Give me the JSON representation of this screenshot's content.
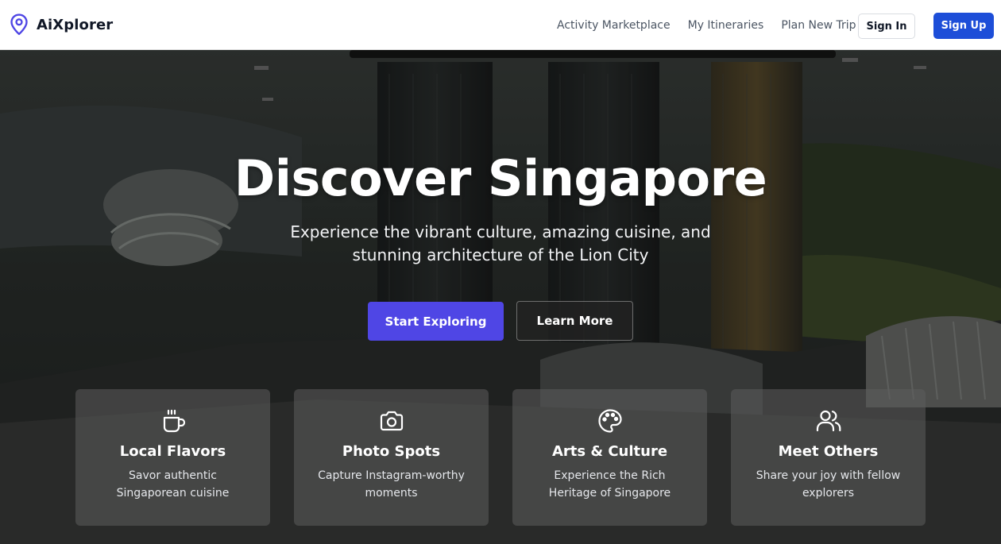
{
  "brand": {
    "name": "AiXplorer",
    "icon": "map-pin-icon",
    "accent": "#4f46e5"
  },
  "nav": {
    "links": [
      {
        "label": "Activity Marketplace"
      },
      {
        "label": "My Itineraries"
      },
      {
        "label": "Plan New Trip"
      }
    ],
    "sign_in": "Sign In",
    "sign_up": "Sign Up"
  },
  "hero": {
    "title": "Discover Singapore",
    "subtitle": "Experience the vibrant culture, amazing cuisine, and stunning architecture of the Lion City",
    "primary_cta": "Start Exploring",
    "secondary_cta": "Learn More"
  },
  "features": [
    {
      "icon": "coffee-cup-icon",
      "title": "Local Flavors",
      "description": "Savor authentic Singaporean cuisine"
    },
    {
      "icon": "camera-icon",
      "title": "Photo Spots",
      "description": "Capture Instagram-worthy moments"
    },
    {
      "icon": "palette-icon",
      "title": "Arts & Culture",
      "description": "Experience the Rich Heritage of Singapore"
    },
    {
      "icon": "users-icon",
      "title": "Meet Others",
      "description": "Share your joy with fellow explorers"
    }
  ],
  "colors": {
    "primary_button": "#4f46e5",
    "sign_up_button": "#1d4ed8",
    "nav_text": "#4b5563"
  }
}
